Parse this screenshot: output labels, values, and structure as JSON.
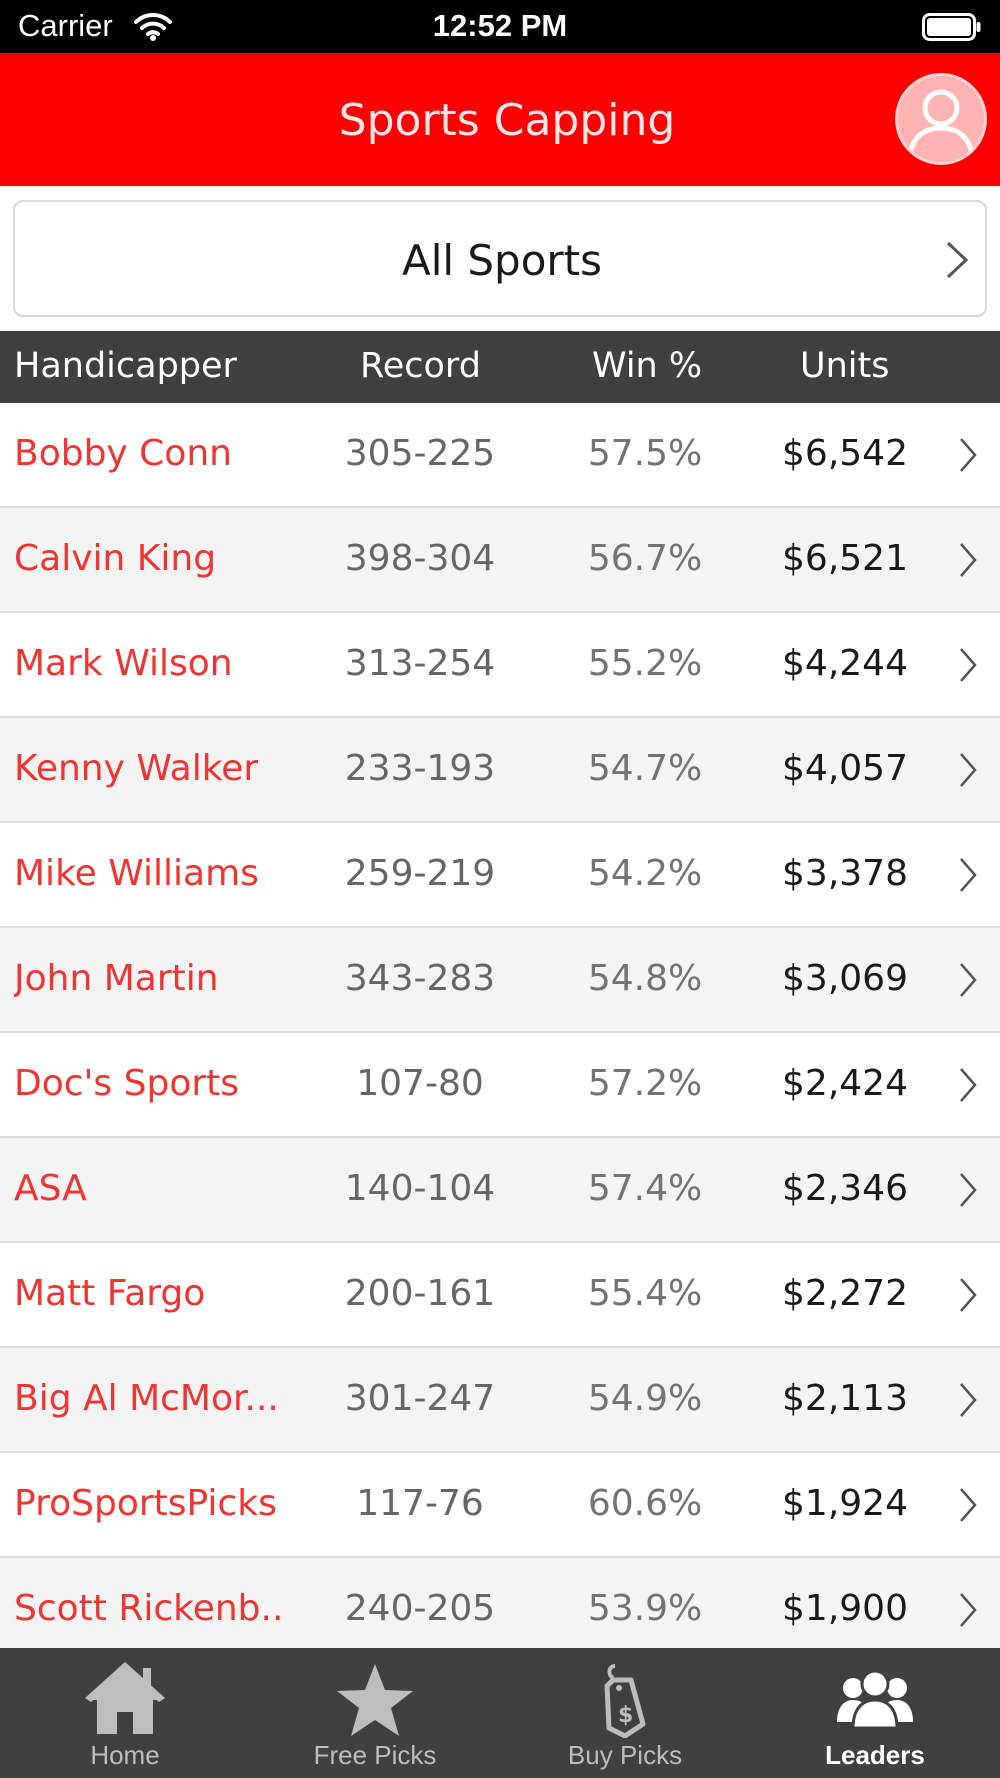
{
  "status_bar": {
    "carrier": "Carrier",
    "time": "12:52 PM"
  },
  "nav": {
    "title": "Sports Capping",
    "profile_icon": "user-icon"
  },
  "filter": {
    "label": "All Sports",
    "chevron_icon": "chevron-right-icon"
  },
  "table": {
    "headers": {
      "handicapper": "Handicapper",
      "record": "Record",
      "win_pct": "Win %",
      "units": "Units"
    },
    "rows": [
      {
        "name": "Bobby Conn",
        "record": "305-225",
        "win": "57.5%",
        "units": "$6,542"
      },
      {
        "name": "Calvin King",
        "record": "398-304",
        "win": "56.7%",
        "units": "$6,521"
      },
      {
        "name": "Mark Wilson",
        "record": "313-254",
        "win": "55.2%",
        "units": "$4,244"
      },
      {
        "name": "Kenny Walker",
        "record": "233-193",
        "win": "54.7%",
        "units": "$4,057"
      },
      {
        "name": "Mike Williams",
        "record": "259-219",
        "win": "54.2%",
        "units": "$3,378"
      },
      {
        "name": "John Martin",
        "record": "343-283",
        "win": "54.8%",
        "units": "$3,069"
      },
      {
        "name": "Doc's Sports",
        "record": "107-80",
        "win": "57.2%",
        "units": "$2,424"
      },
      {
        "name": "ASA",
        "record": "140-104",
        "win": "57.4%",
        "units": "$2,346"
      },
      {
        "name": "Matt Fargo",
        "record": "200-161",
        "win": "55.4%",
        "units": "$2,272"
      },
      {
        "name": "Big Al McMor...",
        "record": "301-247",
        "win": "54.9%",
        "units": "$2,113"
      },
      {
        "name": "ProSportsPicks",
        "record": "117-76",
        "win": "60.6%",
        "units": "$1,924"
      },
      {
        "name": "Scott Rickenb...",
        "record": "240-205",
        "win": "53.9%",
        "units": "$1,900"
      }
    ]
  },
  "tabs": [
    {
      "label": "Home",
      "icon": "home-icon",
      "active": false
    },
    {
      "label": "Free Picks",
      "icon": "star-icon",
      "active": false
    },
    {
      "label": "Buy Picks",
      "icon": "price-tag-icon",
      "active": false
    },
    {
      "label": "Leaders",
      "icon": "group-icon",
      "active": true
    }
  ],
  "colors": {
    "brand_red": "#ff0000",
    "name_red": "#f03333",
    "header_dark": "#404040"
  }
}
